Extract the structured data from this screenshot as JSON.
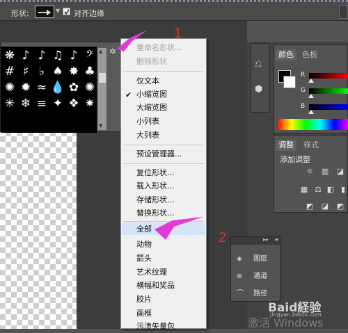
{
  "options_bar": {
    "shape_label": "形状:",
    "align_edges_label": "对齐边缘",
    "align_edges_checked": true
  },
  "shape_picker": {
    "shapes": [
      "❋",
      "♪",
      "♪",
      "♫",
      "♪",
      "𝄢",
      "#",
      "♯",
      "♭",
      "♠",
      "✸",
      "♣",
      "✺",
      "✹",
      "≈",
      "💧",
      "✿",
      "✺",
      "✳",
      "❄",
      "≡",
      "✦",
      "❖",
      "✷"
    ]
  },
  "context_menu": {
    "group1": [
      "重命名形状...",
      "删除形状"
    ],
    "group2": [
      "仅文本",
      "小缩览图",
      "大缩览图",
      "小列表",
      "大列表"
    ],
    "checked_item": "小缩览图",
    "group3": [
      "预设管理器..."
    ],
    "group4": [
      "复位形状...",
      "载入形状...",
      "存储形状...",
      "替换形状..."
    ],
    "group5": [
      "全部",
      "动物",
      "箭头",
      "艺术纹理",
      "横幅和奖品",
      "胶片",
      "画框",
      "污渍矢量包"
    ],
    "highlighted_item": "全部"
  },
  "annotations": {
    "step1": "1",
    "step2": "2",
    "arrow_color": "#e23ad6"
  },
  "color_panel": {
    "tabs": [
      "颜色",
      "色板"
    ],
    "channels": [
      "R",
      "G",
      "B"
    ]
  },
  "adjustments_panel": {
    "tabs": [
      "调整",
      "样式"
    ],
    "title": "添加调整"
  },
  "layers_mini_panel": {
    "items": [
      {
        "label": "图层",
        "icon": "layers-icon"
      },
      {
        "label": "通道",
        "icon": "channels-icon"
      },
      {
        "label": "路径",
        "icon": "paths-icon"
      }
    ]
  },
  "watermark": {
    "logo": "Baid経验",
    "url": "jingyan.baidu.com",
    "windows_text": "激活 Windows"
  }
}
